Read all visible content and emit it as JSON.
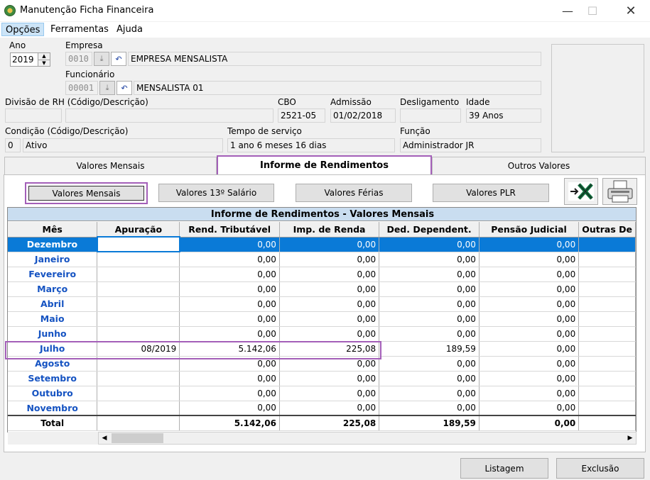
{
  "window": {
    "title": "Manutenção Ficha Financeira"
  },
  "menu": {
    "opcoes": "Opções",
    "ferramentas": "Ferramentas",
    "ajuda": "Ajuda"
  },
  "form": {
    "ano_label": "Ano",
    "ano_value": "2019",
    "empresa_label": "Empresa",
    "empresa_code": "0010",
    "empresa_name": "EMPRESA MENSALISTA",
    "funcionario_label": "Funcionário",
    "funcionario_code": "00001",
    "funcionario_name": "MENSALISTA 01",
    "divisao_label": "Divisão de RH (Código/Descrição)",
    "divisao_code": "",
    "divisao_desc": "",
    "cbo_label": "CBO",
    "cbo_value": "2521-05",
    "admissao_label": "Admissão",
    "admissao_value": "01/02/2018",
    "desligamento_label": "Desligamento",
    "desligamento_value": "",
    "idade_label": "Idade",
    "idade_value": "39 Anos",
    "condicao_label": "Condição (Código/Descrição)",
    "condicao_code": "0",
    "condicao_desc": "Ativo",
    "tempo_label": "Tempo de serviço",
    "tempo_value": "1 ano 6 meses 16 dias",
    "funcao_label": "Função",
    "funcao_value": "Administrador JR"
  },
  "tabs": {
    "valores_mensais": "Valores Mensais",
    "informe": "Informe de Rendimentos",
    "outros": "Outros Valores"
  },
  "buttons": {
    "valores_mensais": "Valores Mensais",
    "valores_13": "Valores 13º Salário",
    "valores_ferias": "Valores Férias",
    "valores_plr": "Valores PLR",
    "listagem": "Listagem",
    "exclusao": "Exclusão"
  },
  "grid": {
    "title": "Informe de Rendimentos - Valores Mensais",
    "columns": [
      "Mês",
      "Apuração",
      "Rend. Tributável",
      "Imp. de Renda",
      "Ded. Dependent.",
      "Pensão Judicial",
      "Outras De"
    ],
    "rows": [
      [
        "Dezembro",
        "",
        "0,00",
        "0,00",
        "0,00",
        "0,00",
        ""
      ],
      [
        "Janeiro",
        "",
        "0,00",
        "0,00",
        "0,00",
        "0,00",
        ""
      ],
      [
        "Fevereiro",
        "",
        "0,00",
        "0,00",
        "0,00",
        "0,00",
        ""
      ],
      [
        "Março",
        "",
        "0,00",
        "0,00",
        "0,00",
        "0,00",
        ""
      ],
      [
        "Abril",
        "",
        "0,00",
        "0,00",
        "0,00",
        "0,00",
        ""
      ],
      [
        "Maio",
        "",
        "0,00",
        "0,00",
        "0,00",
        "0,00",
        ""
      ],
      [
        "Junho",
        "",
        "0,00",
        "0,00",
        "0,00",
        "0,00",
        ""
      ],
      [
        "Julho",
        "08/2019",
        "5.142,06",
        "225,08",
        "189,59",
        "0,00",
        ""
      ],
      [
        "Agosto",
        "",
        "0,00",
        "0,00",
        "0,00",
        "0,00",
        ""
      ],
      [
        "Setembro",
        "",
        "0,00",
        "0,00",
        "0,00",
        "0,00",
        ""
      ],
      [
        "Outubro",
        "",
        "0,00",
        "0,00",
        "0,00",
        "0,00",
        ""
      ],
      [
        "Novembro",
        "",
        "0,00",
        "0,00",
        "0,00",
        "0,00",
        ""
      ]
    ],
    "total": [
      "Total",
      "",
      "5.142,06",
      "225,08",
      "189,59",
      "0,00",
      ""
    ]
  }
}
